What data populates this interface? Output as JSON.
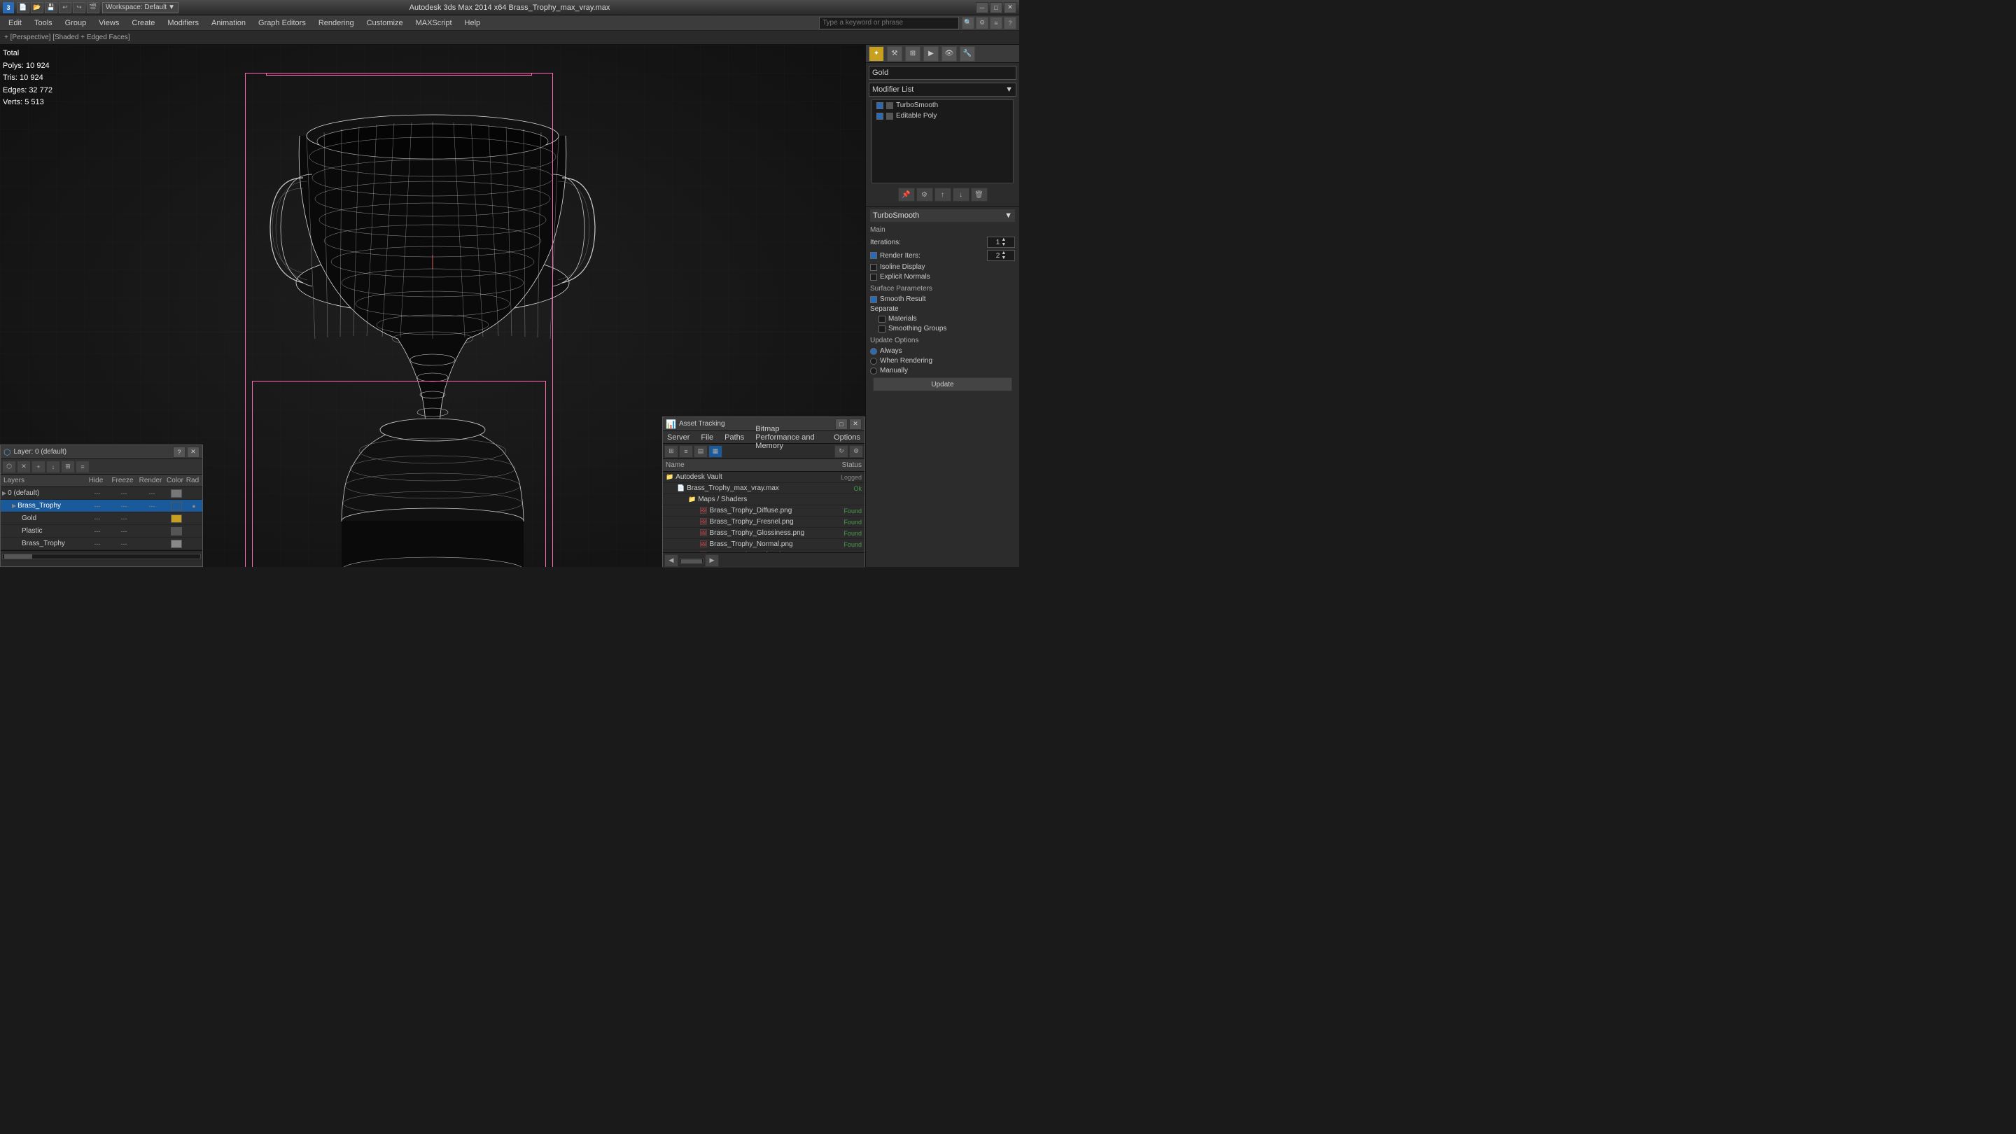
{
  "titleBar": {
    "appName": "3",
    "title": "Autodesk 3ds Max 2014 x64     Brass_Trophy_max_vray.max",
    "workspace": "Workspace: Default",
    "minLabel": "─",
    "maxLabel": "□",
    "closeLabel": "✕"
  },
  "menuBar": {
    "items": [
      {
        "label": "Edit"
      },
      {
        "label": "Tools"
      },
      {
        "label": "Group"
      },
      {
        "label": "Views"
      },
      {
        "label": "Create"
      },
      {
        "label": "Modifiers"
      },
      {
        "label": "Animation"
      },
      {
        "label": "Graph Editors"
      },
      {
        "label": "Rendering"
      },
      {
        "label": "Customize"
      },
      {
        "label": "MAXScript"
      },
      {
        "label": "Help"
      }
    ],
    "searchPlaceholder": "Type a keyword or phrase"
  },
  "viewportHeader": {
    "label": "+ [Perspective] [Shaded + Edged Faces]"
  },
  "stats": {
    "title": "Total",
    "polys": {
      "label": "Polys:",
      "value": "10 924"
    },
    "tris": {
      "label": "Tris:",
      "value": "10 924"
    },
    "edges": {
      "label": "Edges:",
      "value": "32 772"
    },
    "verts": {
      "label": "Verts:",
      "value": "5 513"
    }
  },
  "rightPanel": {
    "objectName": "Gold",
    "modifierListLabel": "Modifier List",
    "modifiers": [
      {
        "name": "TurboSmooth",
        "active": true
      },
      {
        "name": "Editable Poly",
        "active": true
      }
    ],
    "turbosmooth": {
      "title": "TurboSmooth",
      "mainLabel": "Main",
      "iterationsLabel": "Iterations:",
      "iterationsValue": "1",
      "renderItersLabel": "Render Iters:",
      "renderItersValue": "2",
      "isolineDisplayLabel": "Isoline Display",
      "explicitNormalsLabel": "Explicit Normals",
      "surfaceParamsLabel": "Surface Parameters",
      "smoothResultLabel": "Smooth Result",
      "separateLabel": "Separate",
      "materialsLabel": "Materials",
      "smoothingGroupsLabel": "Smoothing Groups",
      "updateOptionsLabel": "Update Options",
      "alwaysLabel": "Always",
      "whenRenderingLabel": "When Rendering",
      "manuallyLabel": "Manually",
      "updateLabel": "Update"
    }
  },
  "layersPanel": {
    "title": "Layer: 0 (default)",
    "columns": {
      "layers": "Layers",
      "hide": "Hide",
      "freeze": "Freeze",
      "render": "Render",
      "color": "Color",
      "rad": "Rad"
    },
    "layers": [
      {
        "indent": 0,
        "name": "0 (default)",
        "hide": "---",
        "freeze": "---",
        "render": "---",
        "color": "#777777",
        "rad": ""
      },
      {
        "indent": 1,
        "name": "Brass_Trophy",
        "hide": "---",
        "freeze": "---",
        "render": "---",
        "color": "#1a5a9a",
        "rad": "●",
        "selected": true
      },
      {
        "indent": 2,
        "name": "Gold",
        "hide": "---",
        "freeze": "---",
        "render": "",
        "color": "#c8a020",
        "rad": ""
      },
      {
        "indent": 2,
        "name": "Plastic",
        "hide": "---",
        "freeze": "---",
        "render": "",
        "color": "#555555",
        "rad": ""
      },
      {
        "indent": 2,
        "name": "Brass_Trophy",
        "hide": "---",
        "freeze": "---",
        "render": "",
        "color": "#888888",
        "rad": ""
      }
    ]
  },
  "assetPanel": {
    "title": "Asset Tracking",
    "menuItems": [
      "Server",
      "File",
      "Paths",
      "Bitmap Performance and Memory",
      "Options"
    ],
    "columns": {
      "name": "Name",
      "status": "Status"
    },
    "assets": [
      {
        "indent": 0,
        "type": "folder",
        "name": "Autodesk Vault",
        "status": "Logged",
        "statusType": "logged"
      },
      {
        "indent": 1,
        "type": "file",
        "name": "Brass_Trophy_max_vray.max",
        "status": "Ok",
        "statusType": "ok"
      },
      {
        "indent": 2,
        "type": "folder",
        "name": "Maps / Shaders",
        "status": "",
        "statusType": ""
      },
      {
        "indent": 3,
        "type": "image",
        "name": "Brass_Trophy_Diffuse.png",
        "status": "Found",
        "statusType": "found"
      },
      {
        "indent": 3,
        "type": "image",
        "name": "Brass_Trophy_Fresnel.png",
        "status": "Found",
        "statusType": "found"
      },
      {
        "indent": 3,
        "type": "image",
        "name": "Brass_Trophy_Glossiness.png",
        "status": "Found",
        "statusType": "found"
      },
      {
        "indent": 3,
        "type": "image",
        "name": "Brass_Trophy_Normal.png",
        "status": "Found",
        "statusType": "found"
      },
      {
        "indent": 3,
        "type": "image",
        "name": "Brass_Trophy_Refraction.png",
        "status": "Found",
        "statusType": "found"
      }
    ]
  }
}
